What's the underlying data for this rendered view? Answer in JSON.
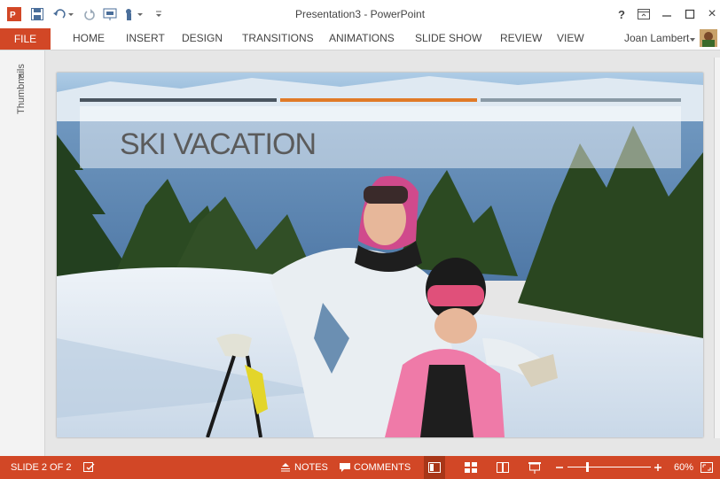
{
  "window": {
    "title": "Presentation3 - PowerPoint",
    "help_label": "?",
    "close_label": "×"
  },
  "ribbon": {
    "file_label": "FILE",
    "tabs": [
      "HOME",
      "INSERT",
      "DESIGN",
      "TRANSITIONS",
      "ANIMATIONS",
      "SLIDE SHOW",
      "REVIEW",
      "VIEW"
    ],
    "user_name": "Joan Lambert"
  },
  "thumbnails": {
    "toggle": "›",
    "label": "Thumbnails"
  },
  "slide": {
    "title": "SKI VACATION",
    "title_color": "#5b5b5b",
    "accent_bars": [
      "#4a5560",
      "#e07a28",
      "#8a9aa6"
    ]
  },
  "status": {
    "slide_indicator": "SLIDE 2 OF 2",
    "notes_label": "NOTES",
    "comments_label": "COMMENTS",
    "zoom_percent": 60,
    "zoom_text": "60%",
    "bar_color": "#d24726"
  }
}
